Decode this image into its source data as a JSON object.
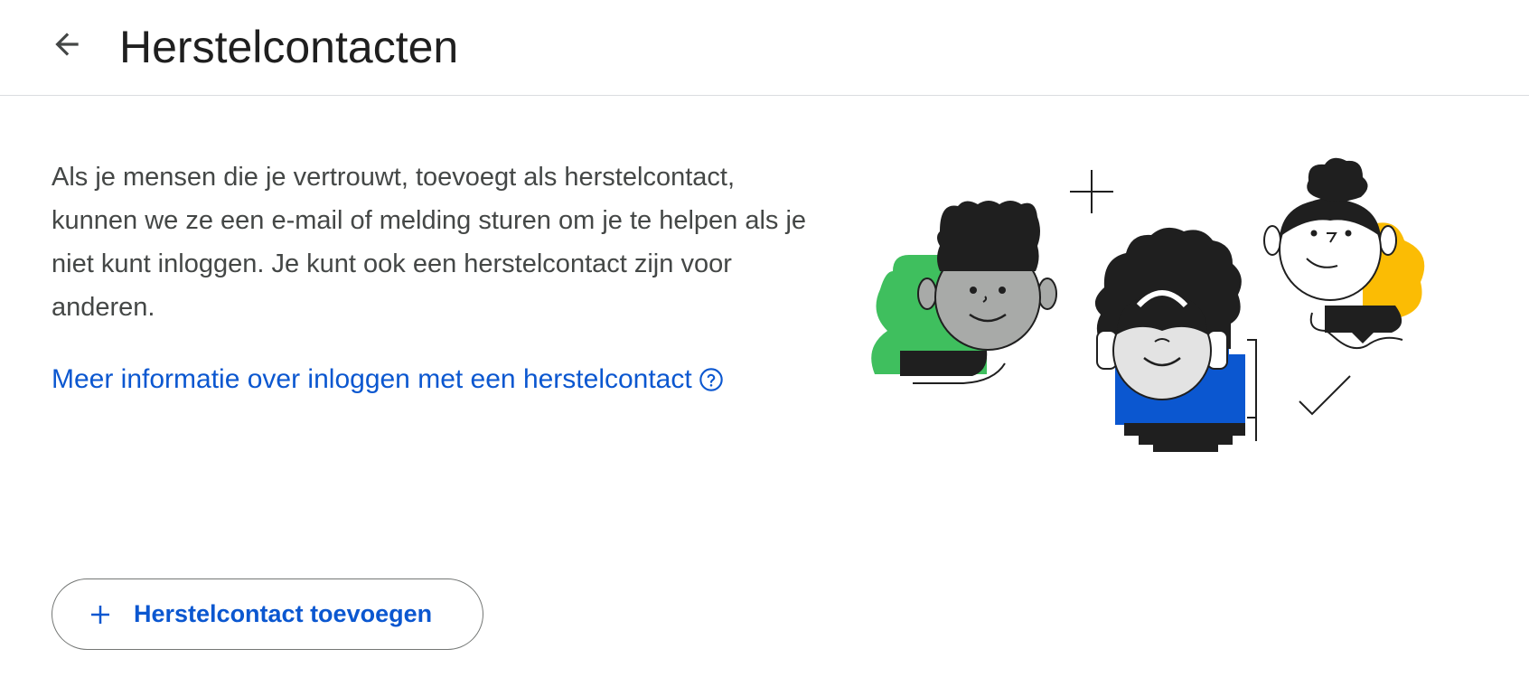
{
  "header": {
    "title": "Herstelcontacten",
    "back_icon": "arrow-back-icon"
  },
  "main": {
    "description": "Als je mensen die je vertrouwt, toevoegt als herstelcontact, kunnen we ze een e-mail of melding sturen om je te helpen als je niet kunt inloggen. Je kunt ook een herstelcontact zijn voor anderen.",
    "learn_more_link": "Meer informatie over inloggen met een herstelcontact",
    "help_icon": "help-circle-icon",
    "add_button_label": "Herstelcontact toevoegen",
    "add_button_icon": "plus-icon"
  },
  "colors": {
    "link": "#0b57d0",
    "title": "#1f1f1f",
    "body_text": "#444746",
    "divider": "#dadce0",
    "illustration_green": "#3fbf5e",
    "illustration_blue": "#0b57d0",
    "illustration_yellow": "#fbbc04"
  }
}
